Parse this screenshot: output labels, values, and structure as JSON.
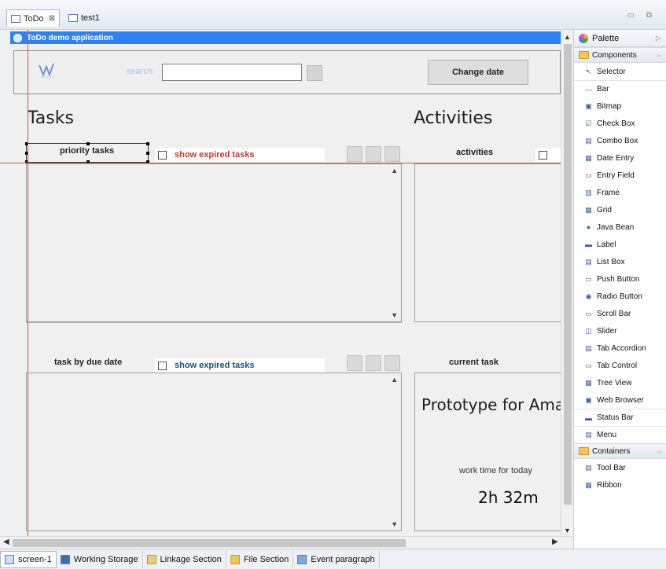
{
  "editor_tabs": [
    {
      "label": "ToDo",
      "active": true
    },
    {
      "label": "test1",
      "active": false
    }
  ],
  "window_buttons": "▭ ⧉",
  "app": {
    "title": "ToDo demo application",
    "search_label": "search",
    "change_date": "Change date",
    "tasks_heading": "Tasks",
    "activities_heading": "Activities",
    "priority_tasks": "priority tasks",
    "show_expired_1": "show expired tasks",
    "activities_label": "activities",
    "task_by_due_date": "task by due date",
    "show_expired_2": "show expired tasks",
    "current_task": "current task",
    "prototype_text": "Prototype for Ama",
    "work_time_label": "work time for today",
    "work_time_value": "2h 32m"
  },
  "colors": {
    "title_bar": "#2f82f2",
    "guide_line": "#e5493e",
    "expired_red": "#c0392b",
    "expired_blue": "#1f4e79"
  },
  "bottom_tabs": [
    {
      "label": "screen-1",
      "icon": "screen-icon",
      "active": true
    },
    {
      "label": "Working Storage",
      "icon": "storage-icon",
      "active": false
    },
    {
      "label": "Linkage Section",
      "icon": "linkage-icon",
      "active": false
    },
    {
      "label": "File Section",
      "icon": "file-section-icon",
      "active": false
    },
    {
      "label": "Event paragraph",
      "icon": "event-icon",
      "active": false
    }
  ],
  "palette": {
    "title": "Palette",
    "components_drawer": "Components",
    "items": [
      {
        "label": "Selector",
        "icon": "selector-icon",
        "glyph": "↖"
      },
      {
        "label": "Bar",
        "icon": "bar-icon",
        "glyph": "—"
      },
      {
        "label": "Bitmap",
        "icon": "bitmap-icon",
        "glyph": "▣"
      },
      {
        "label": "Check Box",
        "icon": "checkbox-icon",
        "glyph": "☑"
      },
      {
        "label": "Combo Box",
        "icon": "combo-box-icon",
        "glyph": "▤"
      },
      {
        "label": "Date Entry",
        "icon": "date-entry-icon",
        "glyph": "▦"
      },
      {
        "label": "Entry Field",
        "icon": "entry-field-icon",
        "glyph": "▭"
      },
      {
        "label": "Frame",
        "icon": "frame-icon",
        "glyph": "▥"
      },
      {
        "label": "Grid",
        "icon": "grid-icon",
        "glyph": "▦"
      },
      {
        "label": "Java Bean",
        "icon": "java-bean-icon",
        "glyph": "●"
      },
      {
        "label": "Label",
        "icon": "label-icon",
        "glyph": "▬"
      },
      {
        "label": "List Box",
        "icon": "list-box-icon",
        "glyph": "▤"
      },
      {
        "label": "Push Button",
        "icon": "push-button-icon",
        "glyph": "▭"
      },
      {
        "label": "Radio Button",
        "icon": "radio-button-icon",
        "glyph": "◉"
      },
      {
        "label": "Scroll Bar",
        "icon": "scroll-bar-icon",
        "glyph": "▭"
      },
      {
        "label": "Slider",
        "icon": "slider-icon",
        "glyph": "◫"
      },
      {
        "label": "Tab Accordion",
        "icon": "tab-accordion-icon",
        "glyph": "▤"
      },
      {
        "label": "Tab Control",
        "icon": "tab-control-icon",
        "glyph": "▭"
      },
      {
        "label": "Tree View",
        "icon": "tree-view-icon",
        "glyph": "▦"
      },
      {
        "label": "Web Browser",
        "icon": "web-browser-icon",
        "glyph": "▣"
      },
      {
        "label": "Status Bar",
        "icon": "status-bar-icon",
        "glyph": "▬"
      },
      {
        "label": "Menu",
        "icon": "menu-icon",
        "glyph": "▤"
      }
    ],
    "containers_drawer": "Containers",
    "container_items": [
      {
        "label": "Tool Bar",
        "icon": "tool-bar-icon",
        "glyph": "▤"
      },
      {
        "label": "Ribbon",
        "icon": "ribbon-icon",
        "glyph": "▦"
      }
    ]
  }
}
